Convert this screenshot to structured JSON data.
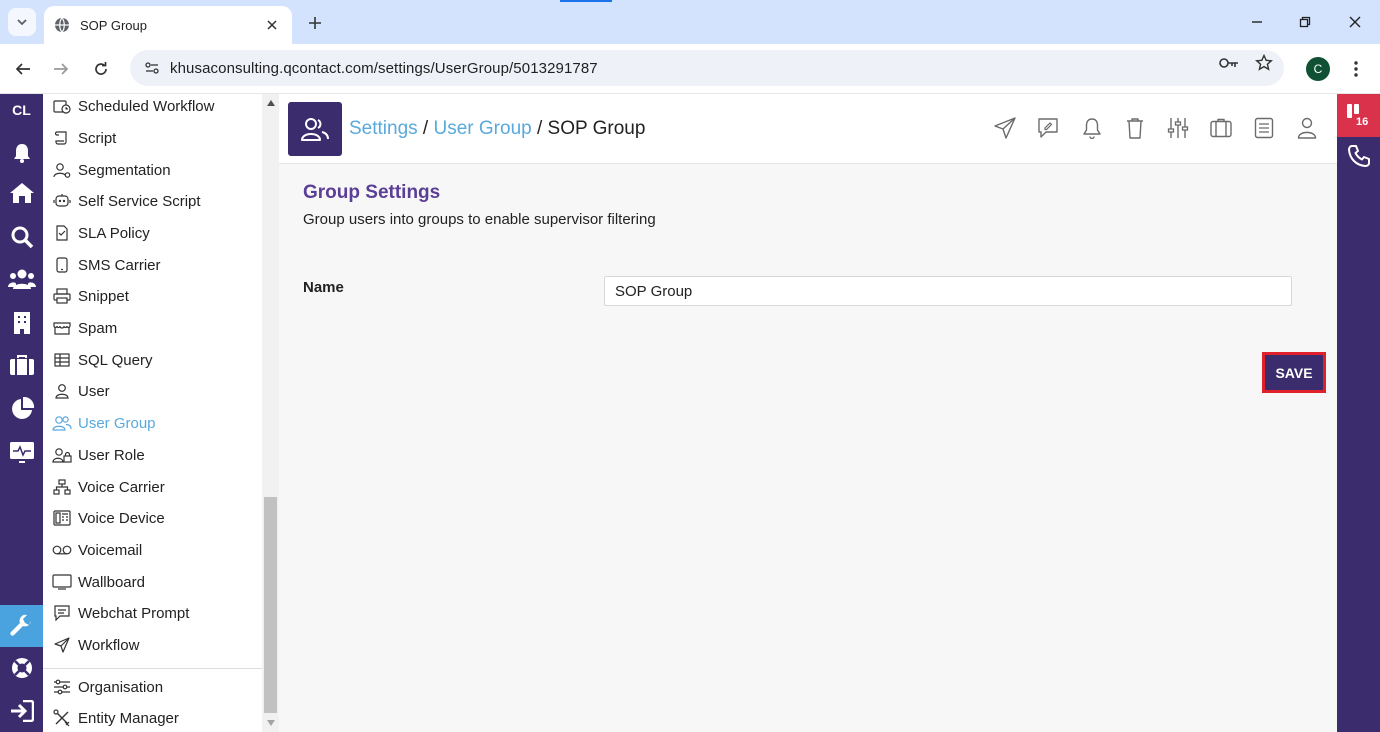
{
  "browser": {
    "tab_title": "SOP Group",
    "url": "khusaconsulting.qcontact.com/settings/UserGroup/5013291787",
    "profile_initial": "C"
  },
  "rail": {
    "org_initials": "CL",
    "icons": [
      "bell-icon",
      "home-icon",
      "search-icon",
      "contacts-icon",
      "building-icon",
      "briefcase-icon",
      "pie-chart-icon",
      "monitor-icon",
      "wrench-icon",
      "lifebuoy-icon",
      "logout-icon"
    ]
  },
  "menu": {
    "items": [
      {
        "label": "Scheduled Workflow",
        "icon": "scheduled-workflow-icon"
      },
      {
        "label": "Script",
        "icon": "script-icon"
      },
      {
        "label": "Segmentation",
        "icon": "segmentation-icon"
      },
      {
        "label": "Self Service Script",
        "icon": "self-service-script-icon"
      },
      {
        "label": "SLA Policy",
        "icon": "sla-policy-icon"
      },
      {
        "label": "SMS Carrier",
        "icon": "sms-carrier-icon"
      },
      {
        "label": "Snippet",
        "icon": "snippet-icon"
      },
      {
        "label": "Spam",
        "icon": "spam-icon"
      },
      {
        "label": "SQL Query",
        "icon": "sql-query-icon"
      },
      {
        "label": "User",
        "icon": "user-icon"
      },
      {
        "label": "User Group",
        "icon": "user-group-icon",
        "active": true
      },
      {
        "label": "User Role",
        "icon": "user-role-icon"
      },
      {
        "label": "Voice Carrier",
        "icon": "voice-carrier-icon"
      },
      {
        "label": "Voice Device",
        "icon": "voice-device-icon"
      },
      {
        "label": "Voicemail",
        "icon": "voicemail-icon"
      },
      {
        "label": "Wallboard",
        "icon": "wallboard-icon"
      },
      {
        "label": "Webchat Prompt",
        "icon": "webchat-prompt-icon"
      },
      {
        "label": "Workflow",
        "icon": "workflow-icon"
      }
    ],
    "footer_items": [
      {
        "label": "Organisation",
        "icon": "organisation-icon"
      },
      {
        "label": "Entity Manager",
        "icon": "entity-manager-icon"
      }
    ]
  },
  "header": {
    "crumb_settings": "Settings",
    "sep1": " / ",
    "crumb_user_group": "User Group",
    "sep2": " / ",
    "current": "SOP Group",
    "actions": [
      "send-icon",
      "comment-icon",
      "bell-outline-icon",
      "trash-icon",
      "sliders-icon",
      "briefcase-outline-icon",
      "list-icon",
      "person-icon"
    ]
  },
  "form": {
    "title": "Group Settings",
    "subtitle": "Group users into groups to enable supervisor filtering",
    "name_label": "Name",
    "name_value": "SOP Group",
    "save_label": "SAVE"
  },
  "right_rail": {
    "notification_count": "16"
  },
  "colors": {
    "brand_purple": "#3b2d6d",
    "accent_blue": "#5aa9dc",
    "title_purple": "#5b3e96",
    "alert_red": "#d9324a"
  }
}
